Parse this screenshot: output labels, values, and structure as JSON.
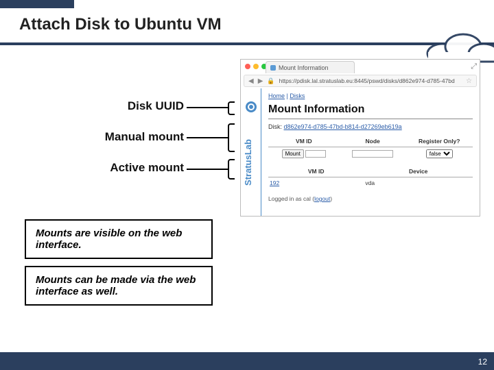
{
  "slide": {
    "title": "Attach Disk to Ubuntu VM",
    "page_number": "12"
  },
  "labels": {
    "uuid": "Disk UUID",
    "manual": "Manual mount",
    "active": "Active mount"
  },
  "notes": {
    "n1": "Mounts are visible on the web interface.",
    "n2": "Mounts can be made via the web interface as well."
  },
  "browser": {
    "tab_title": "Mount Information",
    "url": "https://pdisk.lal.stratuslab.eu:8445/pswd/disks/d862e974-d785-47bd",
    "breadcrumb_home": "Home",
    "breadcrumb_sep": " | ",
    "breadcrumb_disks": "Disks",
    "heading": "Mount Information",
    "disk_label": "Disk:",
    "disk_uuid": "d862e974-d785-47bd-b814-d27269eb619a",
    "table1": {
      "col_vmid": "VM ID",
      "col_node": "Node",
      "col_register": "Register Only?",
      "btn_mount": "Mount",
      "select_false": "false"
    },
    "table2": {
      "col_vmid": "VM ID",
      "col_device": "Device",
      "vmid": "192",
      "device": "vda"
    },
    "logged_prefix": "Logged in as cal (",
    "logout": "logout",
    "logged_suffix": ")"
  },
  "colors": {
    "navy": "#2b3f5e",
    "link": "#2a5ca8"
  }
}
